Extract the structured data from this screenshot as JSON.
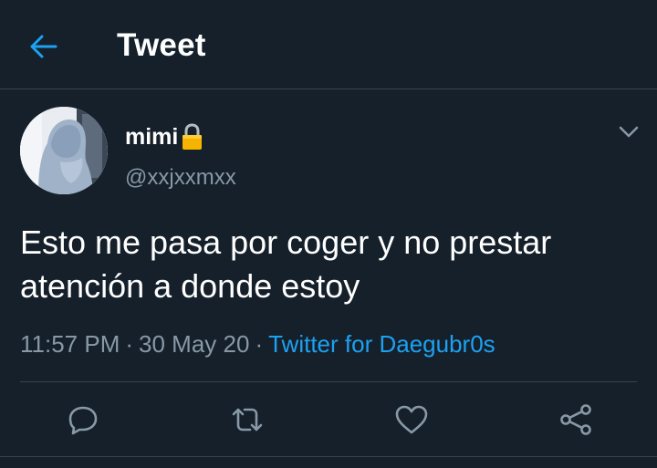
{
  "header": {
    "title": "Tweet",
    "back_icon": "arrow-left-icon"
  },
  "tweet": {
    "author": {
      "display_name": "mimi",
      "protected_icon": "lock-icon",
      "handle": "@xxjxxmxx"
    },
    "text": "Esto me pasa por coger y no prestar atención a donde estoy",
    "time": "11:57 PM",
    "date": "30 May 20",
    "separator": "·",
    "source": "Twitter for Daegubr0s",
    "more_icon": "chevron-down-icon"
  },
  "actions": [
    {
      "name": "reply",
      "icon": "reply-icon"
    },
    {
      "name": "retweet",
      "icon": "retweet-icon"
    },
    {
      "name": "like",
      "icon": "heart-icon"
    },
    {
      "name": "share",
      "icon": "share-icon"
    }
  ],
  "colors": {
    "background": "#15202b",
    "accent": "#1da1f2",
    "secondary_text": "#8899a6",
    "border": "#38444d"
  }
}
